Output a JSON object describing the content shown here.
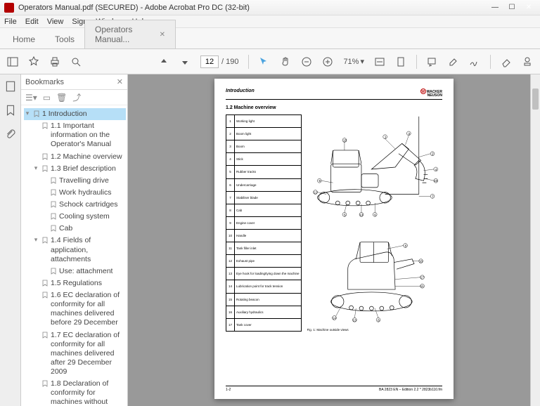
{
  "window": {
    "title": "Operators Manual.pdf (SECURED) - Adobe Acrobat Pro DC (32-bit)"
  },
  "menu": [
    "File",
    "Edit",
    "View",
    "Sign",
    "Window",
    "Help"
  ],
  "tabs": {
    "home": "Home",
    "tools": "Tools",
    "doc": "Operators Manual..."
  },
  "toolbar": {
    "page_current": "12",
    "page_total": "/ 190",
    "zoom": "71%"
  },
  "bookmarks": {
    "title": "Bookmarks",
    "items": [
      {
        "level": 1,
        "tw": "v",
        "label": "1 Introduction",
        "sel": true
      },
      {
        "level": 2,
        "tw": "",
        "label": "1.1 Important information on the Operator's Manual"
      },
      {
        "level": 2,
        "tw": "",
        "label": "1.2 Machine overview"
      },
      {
        "level": 2,
        "tw": "v",
        "label": "1.3 Brief description"
      },
      {
        "level": 3,
        "tw": "",
        "label": "Travelling drive"
      },
      {
        "level": 3,
        "tw": "",
        "label": "Work hydraulics"
      },
      {
        "level": 3,
        "tw": "",
        "label": "Schock cartridges"
      },
      {
        "level": 3,
        "tw": "",
        "label": "Cooling system"
      },
      {
        "level": 3,
        "tw": "",
        "label": "Cab"
      },
      {
        "level": 2,
        "tw": "v",
        "label": "1.4 Fields of application, attachments"
      },
      {
        "level": 3,
        "tw": "",
        "label": "Use: attachment"
      },
      {
        "level": 2,
        "tw": "",
        "label": "1.5 Regulations"
      },
      {
        "level": 2,
        "tw": "",
        "label": "1.6 EC declaration of conformity for all machines delivered before 29 December"
      },
      {
        "level": 2,
        "tw": "",
        "label": "1.7 EC declaration of conformity for all machines delivered after 29 December 2009"
      },
      {
        "level": 2,
        "tw": "",
        "label": "1.8 Declaration of conformity for machines without"
      }
    ]
  },
  "doc": {
    "section": "Introduction",
    "brand1": "WACKER",
    "brand2": "NEUSON",
    "heading": "1.2  Machine overview",
    "parts": [
      [
        1,
        "Working light"
      ],
      [
        2,
        "Boom light"
      ],
      [
        3,
        "Boom"
      ],
      [
        4,
        "Stick"
      ],
      [
        5,
        "Rubber tracks"
      ],
      [
        6,
        "Undercarriage"
      ],
      [
        7,
        "Stabiliser blade"
      ],
      [
        8,
        "Cab"
      ],
      [
        9,
        "Engine cover"
      ],
      [
        10,
        "Handle"
      ],
      [
        11,
        "Tank filler inlet"
      ],
      [
        12,
        "Exhaust pipe"
      ],
      [
        13,
        "Eye hook for loading/tying down the machine"
      ],
      [
        14,
        "Lubrication point for track tension"
      ],
      [
        15,
        "Rotating beacon"
      ],
      [
        16,
        "Auxiliary hydraulics"
      ],
      [
        17,
        "Tank cover"
      ]
    ],
    "caption": "Fig. 1:   Machine outside views",
    "footer_left": "1-2",
    "footer_right": "BA 2823 EN – Edition 2.2 * 2823b110.fm"
  }
}
